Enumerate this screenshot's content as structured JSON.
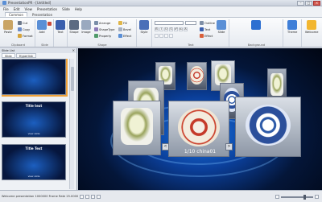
{
  "window": {
    "title": "PresentationPR - [Untitled]",
    "controls": [
      "–",
      "□",
      "×"
    ]
  },
  "menu": [
    "File",
    "Edit",
    "View",
    "Presentation",
    "Slide",
    "Help"
  ],
  "ribbon_tabs": [
    {
      "label": "Common",
      "active": true
    },
    {
      "label": "Presentation",
      "active": false
    }
  ],
  "ribbon": {
    "clipboard": {
      "label": "Clipboard",
      "paste": "Paste",
      "cut": "Cut",
      "copy": "Copy",
      "format": "Format"
    },
    "slide": {
      "label": "Slide",
      "add": "Add",
      "delete": "Delete"
    },
    "text_group": {
      "text": "Text"
    },
    "shape": {
      "label": "Shape",
      "shape": "Shape",
      "image": "Image",
      "arrange": "Arrange",
      "shape_type": "ShapeType",
      "property": "Property",
      "fill": "Fill",
      "bevel": "Bevel",
      "effect": "Effect"
    },
    "style": "Style",
    "font": {
      "label": "Text",
      "format_buttons": [
        "B",
        "I",
        "U",
        "S",
        "x²",
        "x₂",
        "A"
      ],
      "outline": "Outline",
      "text": "Text",
      "effect": "Effect",
      "slide": "Slide"
    },
    "background": {
      "label": "Background",
      "button": "Background"
    },
    "theme": "Theme",
    "welcome": "Welcome"
  },
  "sidebar": {
    "header": "Slide List",
    "tabs": [
      "Slide",
      "Hyperlink"
    ],
    "slides": [
      {
        "title": "",
        "caption": "",
        "selected": true
      },
      {
        "title": "Title text",
        "caption": "view slide",
        "selected": false
      },
      {
        "title": "Title Text",
        "caption": "view slide",
        "selected": false
      }
    ]
  },
  "canvas": {
    "counter": "1/10 china01",
    "prev": "<",
    "next": ">"
  },
  "status": {
    "text": "Welcome presentation  1000000  Frame Rate 25.0000",
    "zoom_percent": 100
  }
}
